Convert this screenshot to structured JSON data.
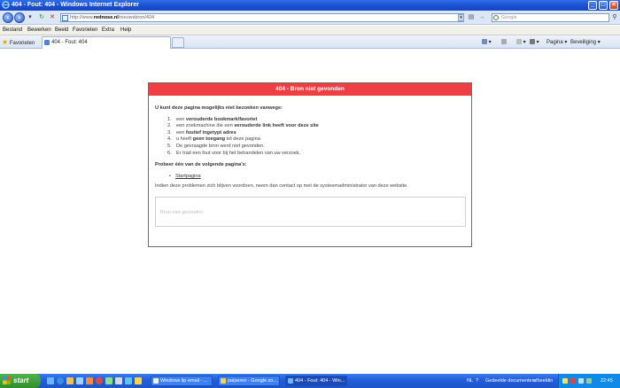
{
  "window": {
    "title": "404 - Fout: 404 - Windows Internet Explorer"
  },
  "address_bar": {
    "url_prefix": "http://www.",
    "url_host": "rednose.nl",
    "url_path": "/nieuwsbron/404",
    "search_placeholder": "Google"
  },
  "menu": [
    "Bestand",
    "Bewerken",
    "Beeld",
    "Favorieten",
    "Extra",
    "Help"
  ],
  "favorites_label": "Favorieten",
  "tab": {
    "label": "404 - Fout: 404"
  },
  "toolbar": {
    "page_label": "Pagina",
    "security_label": "Beveiliging"
  },
  "error_panel": {
    "header": "404 - Bron niet gevonden",
    "reasons_heading": "U kunt deze pagina mogelijks niet bezoeken vanwege:",
    "reasons": [
      {
        "num": "1.",
        "pre": "een ",
        "bold": "verouderde bookmark/favoriet",
        "post": ""
      },
      {
        "num": "2.",
        "pre": "een zoekmachine die een ",
        "bold": "verouderde link heeft voor deze site",
        "post": ""
      },
      {
        "num": "3.",
        "pre": "een ",
        "bold": "foutief ingetypt adres",
        "post": ""
      },
      {
        "num": "4.",
        "pre": "u heeft ",
        "bold": "geen toegang",
        "post": " tot deze pagina"
      },
      {
        "num": "5.",
        "pre": "De gevraagde bron werd niet gevonden.",
        "bold": "",
        "post": ""
      },
      {
        "num": "6.",
        "pre": "Er trad een fout voor bij het behandelen van uw verzoek.",
        "bold": "",
        "post": ""
      }
    ],
    "try_heading": "Probeer één van de volgende pagina's:",
    "start_link": "Startpagina",
    "contact_text": "Indien deze problemen zich blijven voordoen, neem dan contact op met de systeemadministrator van deze website.",
    "detail_box": "Bron niet gevonden"
  },
  "taskbar": {
    "start_label": "start",
    "tasks": [
      {
        "label": "Windows lip email - ..."
      },
      {
        "label": "palperen - Google zo..."
      },
      {
        "label": "404 - Fout: 404 - Win..."
      }
    ],
    "tray": {
      "language": "NL",
      "shared_docs": "Gedeelde documenten",
      "pictures": "afbeeldin",
      "clock": "22:45"
    }
  },
  "colors": {
    "panel_header": "#ef3f45",
    "titlebar": "#1a4fd0",
    "taskbar": "#245fdc",
    "start_button": "#2f8e2a"
  }
}
